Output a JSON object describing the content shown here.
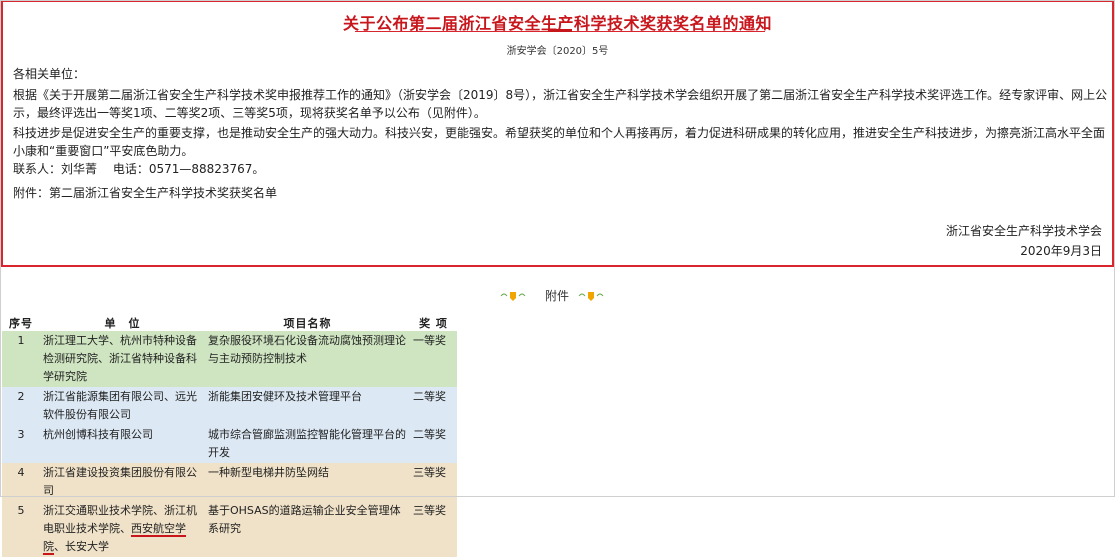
{
  "notice": {
    "title": "关于公布第二届浙江省安全生产科学技术奖获奖名单的通知",
    "doc_number": "浙安学会〔2020〕5号",
    "salutation": "各相关单位：",
    "para1": "根据《关于开展第二届浙江省安全生产科学技术奖申报推荐工作的通知》（浙安学会〔2019〕8号），浙江省安全生产科学技术学会组织开展了第二届浙江省安全生产科学技术奖评选工作。经专家评审、网上公示，最终评选出一等奖1项、二等奖2项、三等奖5项，现将获奖名单予以公布（见附件）。",
    "para2": "科技进步是促进安全生产的重要支撑，也是推动安全生产的强大动力。科技兴安，更能强安。希望获奖的单位和个人再接再厉，着力促进科研成果的转化应用，推进安全生产科技进步，为擦亮浙江高水平全面小康和“重要窗口”平安底色助力。",
    "contact": "联系人：刘华菁　 电话：0571—88823767。",
    "attachment": "附件：第二届浙江省安全生产科学技术奖获奖名单",
    "org": "浙江省安全生产科学技术学会",
    "date": "2020年9月3日"
  },
  "attachment_heading": "附件",
  "table": {
    "headers": [
      "序号",
      "单　位",
      "项目名称",
      "奖 项"
    ],
    "rows": [
      {
        "no": "1",
        "unit": "浙江理工大学、杭州市特种设备检测研究院、浙江省特种设备科学研究院",
        "project": "复杂服役环境石化设备流动腐蚀预测理论与主动预防控制技术",
        "award": "一等奖"
      },
      {
        "no": "2",
        "unit": "浙江省能源集团有限公司、远光软件股份有限公司",
        "project": "浙能集团安健环及技术管理平台",
        "award": "二等奖"
      },
      {
        "no": "3",
        "unit": "杭州创博科技有限公司",
        "project": "城市综合管廊监测监控智能化管理平台的开发",
        "award": "二等奖"
      },
      {
        "no": "4",
        "unit": "浙江省建设投资集团股份有限公司",
        "project": "一种新型电梯井防坠网结",
        "award": "三等奖"
      },
      {
        "no": "5",
        "unit_pre": "浙江交通职业技术学院、浙江机电职业技术学院、",
        "unit_mark": "西安航空学院",
        "unit_post": "、长安大学",
        "project": "基于OHSAS的道路运输企业安全管理体系研究",
        "award": "三等奖"
      }
    ]
  },
  "colors": {
    "accent_red": "#c8161d",
    "row_green": "#cfe5c1",
    "row_blue": "#dce8f4",
    "row_tan": "#f0e2c8"
  }
}
